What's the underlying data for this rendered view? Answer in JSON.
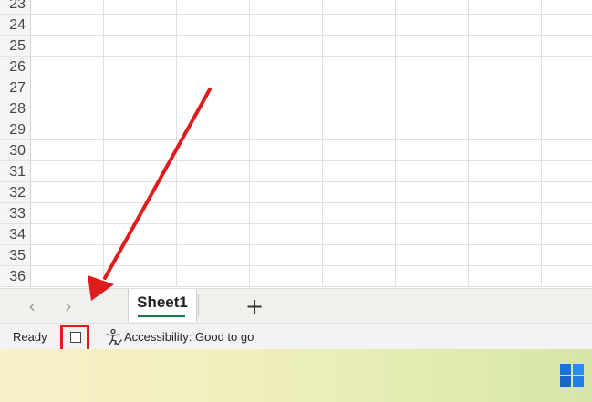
{
  "grid": {
    "row_numbers": [
      "23",
      "24",
      "25",
      "26",
      "27",
      "28",
      "29",
      "30",
      "31",
      "32",
      "33",
      "34",
      "35",
      "36"
    ]
  },
  "tab_bar": {
    "prev_arrow": "‹",
    "next_arrow": "›",
    "sheet_tab_label": "Sheet1",
    "add_sheet_glyph": "+"
  },
  "status_bar": {
    "ready_label": "Ready",
    "accessibility_label": "Accessibility: Good to go"
  },
  "colors": {
    "annotation_red": "#e01b1b",
    "sheet_tab_accent": "#107c41"
  },
  "icons": {
    "accessibility": "accessibility-icon",
    "windows": "windows-start-icon",
    "macro_record": "macro-record-icon"
  }
}
